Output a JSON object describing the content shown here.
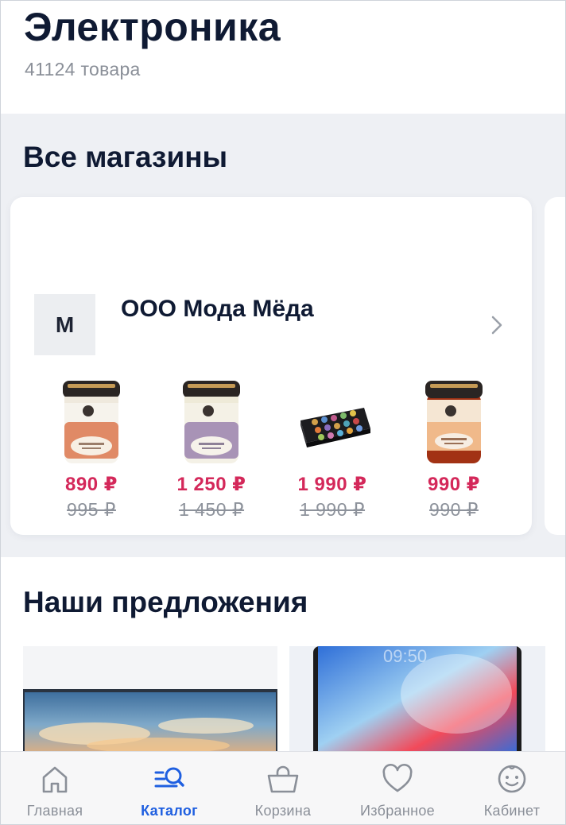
{
  "header": {
    "title": "Электроника",
    "count": "41124 товара"
  },
  "stores": {
    "title": "Все магазины",
    "card": {
      "logo_letter": "М",
      "name": "ООО Мода Мёда",
      "products": [
        {
          "price": "890 ₽",
          "old_price": "995 ₽",
          "icon": "honey-jar-orange"
        },
        {
          "price": "1 250 ₽",
          "old_price": "1 450 ₽",
          "icon": "honey-jar-lilac"
        },
        {
          "price": "1 990 ₽",
          "old_price": "1 990 ₽",
          "icon": "honey-gift-box"
        },
        {
          "price": "990 ₽",
          "old_price": "990 ₽",
          "icon": "honey-jar-peach"
        }
      ]
    }
  },
  "offers": {
    "title": "Наши предложения"
  },
  "nav": {
    "items": [
      {
        "label": "Главная",
        "icon": "home-icon",
        "active": false
      },
      {
        "label": "Каталог",
        "icon": "catalog-search-icon",
        "active": true
      },
      {
        "label": "Корзина",
        "icon": "basket-icon",
        "active": false
      },
      {
        "label": "Избранное",
        "icon": "heart-icon",
        "active": false
      },
      {
        "label": "Кабинет",
        "icon": "smiley-icon",
        "active": false
      }
    ]
  },
  "colors": {
    "accent": "#1f5fe0",
    "price": "#d4285a",
    "title": "#0f1a33"
  }
}
